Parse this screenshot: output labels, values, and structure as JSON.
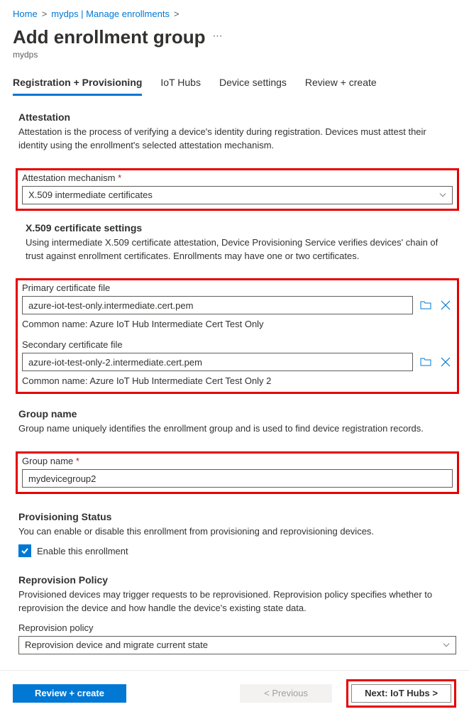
{
  "breadcrumb": {
    "home": "Home",
    "path": "mydps | Manage enrollments"
  },
  "page": {
    "title": "Add enrollment group",
    "subtitle": "mydps"
  },
  "tabs": {
    "registration": "Registration + Provisioning",
    "iothubs": "IoT Hubs",
    "device": "Device settings",
    "review": "Review + create"
  },
  "attestation": {
    "heading": "Attestation",
    "desc": "Attestation is the process of verifying a device's identity during registration. Devices must attest their identity using the enrollment's selected attestation mechanism.",
    "mech_label": "Attestation mechanism",
    "mech_value": "X.509 intermediate certificates"
  },
  "x509": {
    "heading": "X.509 certificate settings",
    "desc": "Using intermediate X.509 certificate attestation, Device Provisioning Service verifies devices' chain of trust against enrollment certificates. Enrollments may have one or two certificates.",
    "primary_label": "Primary certificate file",
    "primary_value": "azure-iot-test-only.intermediate.cert.pem",
    "primary_cn": "Common name: Azure IoT Hub Intermediate Cert Test Only",
    "secondary_label": "Secondary certificate file",
    "secondary_value": "azure-iot-test-only-2.intermediate.cert.pem",
    "secondary_cn": "Common name: Azure IoT Hub Intermediate Cert Test Only 2"
  },
  "group": {
    "heading": "Group name",
    "desc": "Group name uniquely identifies the enrollment group and is used to find device registration records.",
    "label": "Group name",
    "value": "mydevicegroup2"
  },
  "provisioning": {
    "heading": "Provisioning Status",
    "desc": "You can enable or disable this enrollment from provisioning and reprovisioning devices.",
    "enable_label": "Enable this enrollment"
  },
  "reprovision": {
    "heading": "Reprovision Policy",
    "desc": "Provisioned devices may trigger requests to be reprovisioned. Reprovision policy specifies whether to reprovision the device and how handle the device's existing state data.",
    "label": "Reprovision policy",
    "value": "Reprovision device and migrate current state"
  },
  "footer": {
    "review": "Review + create",
    "previous": "< Previous",
    "next": "Next: IoT Hubs >"
  }
}
